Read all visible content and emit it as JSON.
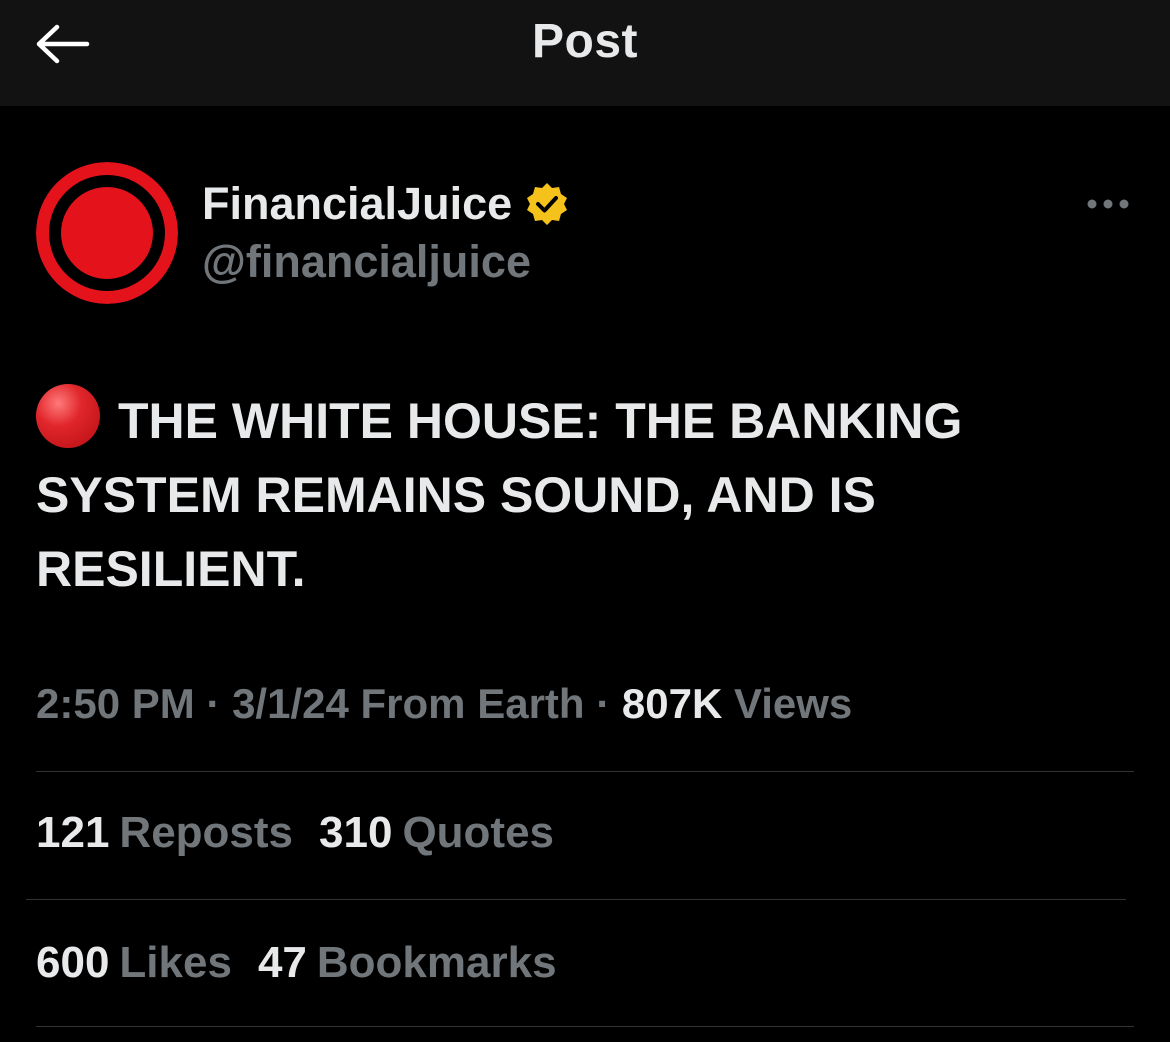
{
  "header": {
    "title": "Post",
    "back_icon": "back-arrow-icon"
  },
  "author": {
    "display_name": "FinancialJuice",
    "handle": "@financialjuice",
    "verified": true,
    "verified_badge_color": "#f4c21b",
    "avatar_color": "#e3121b",
    "more_icon": "more-horizontal-icon"
  },
  "post": {
    "emoji": "red-circle-emoji",
    "text": "THE WHITE HOUSE: THE BANKING SYSTEM REMAINS SOUND, AND IS RESILIENT."
  },
  "meta": {
    "time": "2:50 PM",
    "separator": "·",
    "date": "3/1/24",
    "source": "From Earth",
    "views_count": "807K",
    "views_label": "Views"
  },
  "stats": {
    "reposts_count": "121",
    "reposts_label": "Reposts",
    "quotes_count": "310",
    "quotes_label": "Quotes",
    "likes_count": "600",
    "likes_label": "Likes",
    "bookmarks_count": "47",
    "bookmarks_label": "Bookmarks"
  },
  "colors": {
    "background": "#000000",
    "header_background": "#121212",
    "primary_text": "#e7e9ea",
    "secondary_text": "#71767b",
    "divider": "#2f3336"
  }
}
